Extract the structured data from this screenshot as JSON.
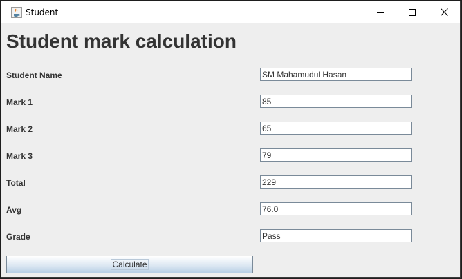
{
  "window": {
    "title": "Student",
    "app_icon": "java-coffee-cup-icon"
  },
  "controls": {
    "minimize_icon": "minimize-icon",
    "maximize_icon": "maximize-icon",
    "close_icon": "close-icon"
  },
  "form": {
    "heading": "Student mark calculation",
    "fields": [
      {
        "label": "Student Name",
        "value": "SM Mahamudul Hasan"
      },
      {
        "label": "Mark 1",
        "value": "85"
      },
      {
        "label": "Mark 2",
        "value": "65"
      },
      {
        "label": "Mark 3",
        "value": "79"
      },
      {
        "label": "Total",
        "value": "229"
      },
      {
        "label": "Avg",
        "value": "76.0"
      },
      {
        "label": "Grade",
        "value": "Pass"
      }
    ],
    "calculate_label": "Calculate"
  },
  "colors": {
    "background": "#eeeeee",
    "text": "#333333",
    "field_border": "#7a8a99"
  }
}
